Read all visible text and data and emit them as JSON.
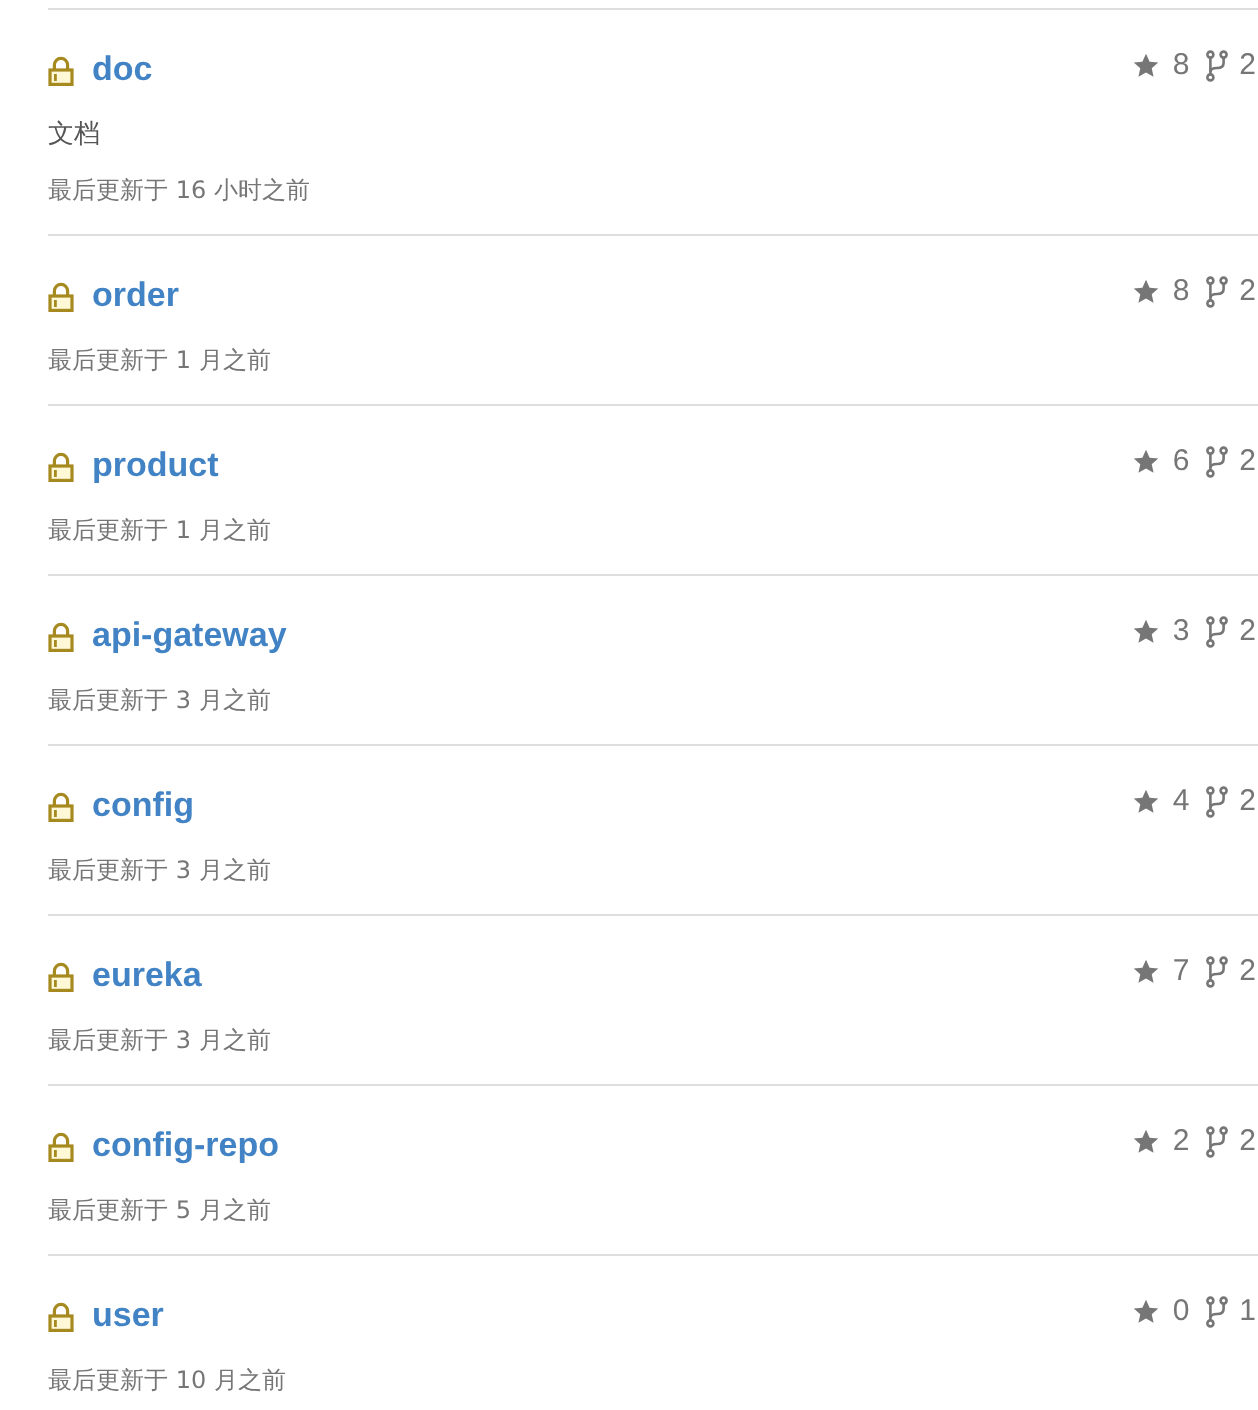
{
  "repositories": [
    {
      "name": "doc",
      "private": true,
      "description": "文档",
      "updated": "最后更新于 16 小时之前",
      "star_count": "8",
      "fork_count": "2"
    },
    {
      "name": "order",
      "private": true,
      "updated": "最后更新于 1 月之前",
      "star_count": "8",
      "fork_count": "2"
    },
    {
      "name": "product",
      "private": true,
      "updated": "最后更新于 1 月之前",
      "star_count": "6",
      "fork_count": "2"
    },
    {
      "name": "api-gateway",
      "private": true,
      "updated": "最后更新于 3 月之前",
      "star_count": "3",
      "fork_count": "2"
    },
    {
      "name": "config",
      "private": true,
      "updated": "最后更新于 3 月之前",
      "star_count": "4",
      "fork_count": "2"
    },
    {
      "name": "eureka",
      "private": true,
      "updated": "最后更新于 3 月之前",
      "star_count": "7",
      "fork_count": "2"
    },
    {
      "name": "config-repo",
      "private": true,
      "updated": "最后更新于 5 月之前",
      "star_count": "2",
      "fork_count": "2"
    },
    {
      "name": "user",
      "private": true,
      "updated": "最后更新于 10 月之前",
      "star_count": "0",
      "fork_count": "1"
    }
  ]
}
